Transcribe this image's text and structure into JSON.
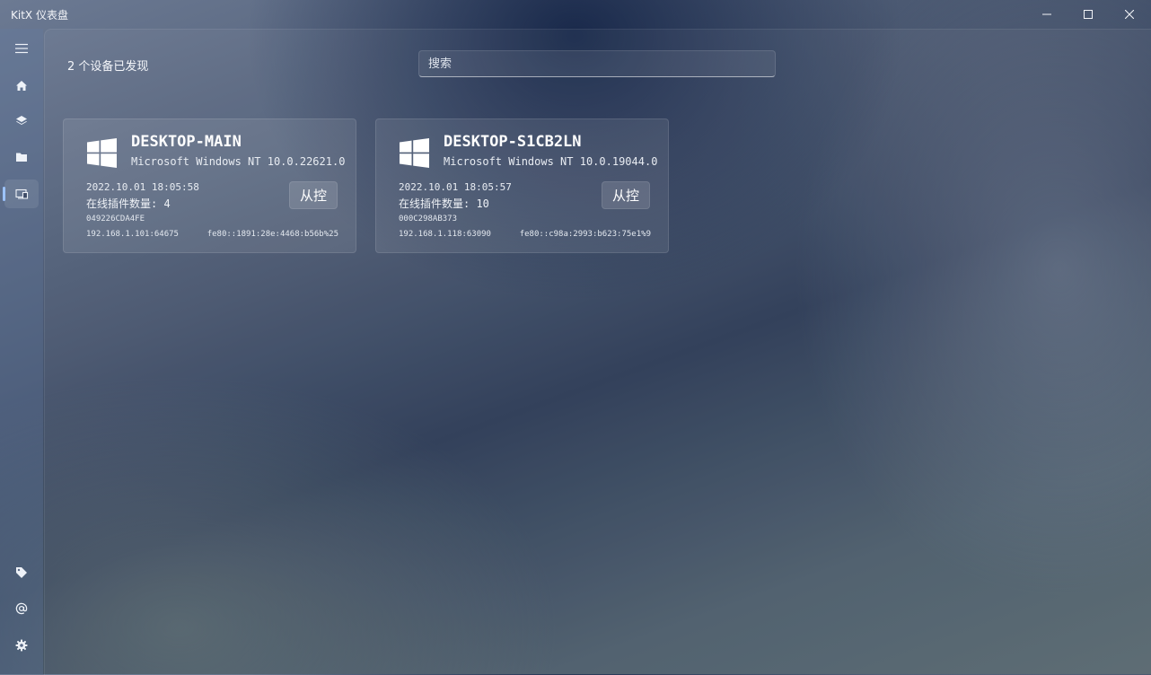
{
  "window": {
    "title": "KitX 仪表盘",
    "controls": [
      "minimize-icon",
      "maximize-icon",
      "close-icon"
    ]
  },
  "sidebar": {
    "top_items": [
      {
        "icon": "hamburger-menu-icon"
      },
      {
        "icon": "home-icon"
      },
      {
        "icon": "layers-icon"
      },
      {
        "icon": "folder-icon"
      },
      {
        "icon": "devices-icon",
        "active": true
      }
    ],
    "bottom_items": [
      {
        "icon": "tag-icon"
      },
      {
        "icon": "at-sign-icon"
      },
      {
        "icon": "gear-icon"
      }
    ]
  },
  "main": {
    "device_count_label": "2 个设备已发现",
    "search": {
      "placeholder": "搜索",
      "value": ""
    },
    "devices": [
      {
        "name": "DESKTOP-MAIN",
        "os": "Microsoft Windows NT 10.0.22621.0",
        "time": "2022.10.01 18:05:58",
        "plugins": "在线插件数量: 4",
        "mac": "049226CDA4FE",
        "ipv4": "192.168.1.101:64675",
        "ipv6": "fe80::1891:28e:4468:b56b%25",
        "control_label": "从控",
        "os_icon": "windows-logo-icon"
      },
      {
        "name": "DESKTOP-S1CB2LN",
        "os": "Microsoft Windows NT 10.0.19044.0",
        "time": "2022.10.01 18:05:57",
        "plugins": "在线插件数量: 10",
        "mac": "000C298AB373",
        "ipv4": "192.168.1.118:63090",
        "ipv6": "fe80::c98a:2993:b623:75e1%9",
        "control_label": "从控",
        "os_icon": "windows-logo-icon"
      }
    ]
  },
  "colors": {
    "accent": "#9cc3ff",
    "card_background": "rgba(255,255,255,0.085)"
  }
}
